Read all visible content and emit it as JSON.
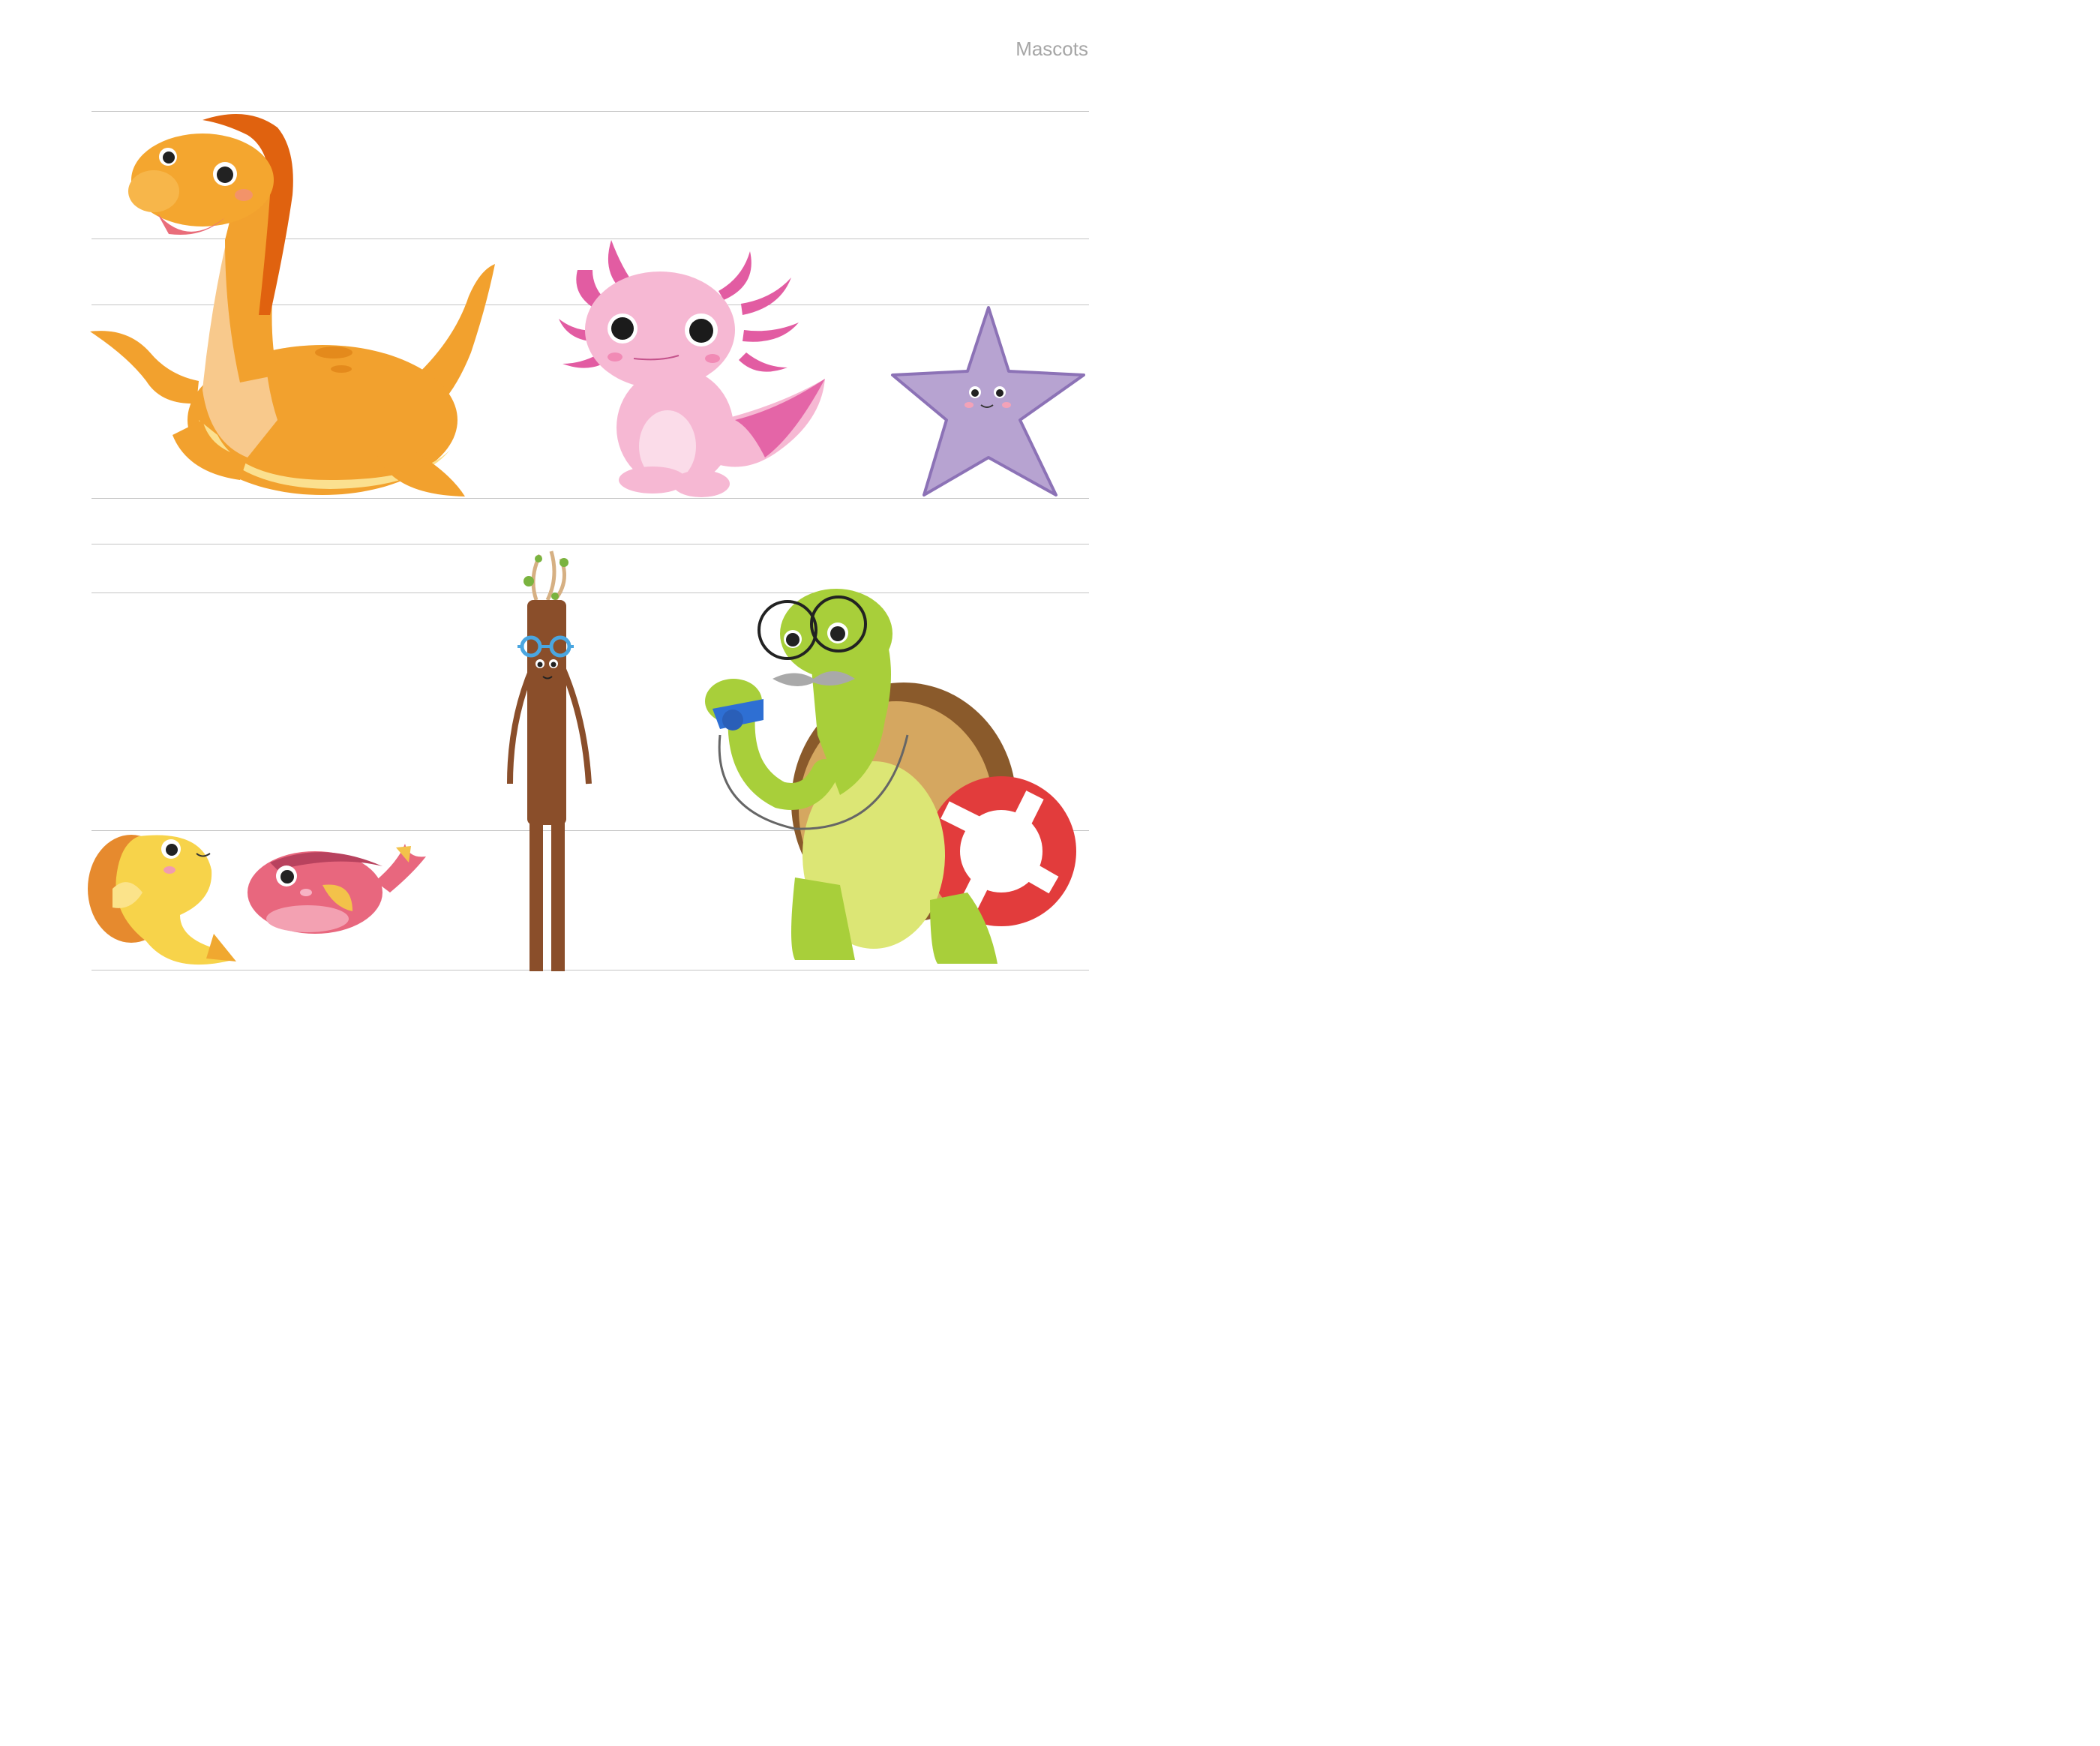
{
  "page": {
    "title": "Mascots"
  },
  "mascots": [
    {
      "name": "plesiosaur",
      "color": "#f2a12e"
    },
    {
      "name": "axolotl",
      "color": "#f6b8d3"
    },
    {
      "name": "starfish",
      "color": "#b7a3d1"
    },
    {
      "name": "yellow-fish",
      "color": "#f7d34a"
    },
    {
      "name": "pink-fish",
      "color": "#e8677e"
    },
    {
      "name": "stick-figure",
      "color": "#8a4e2a"
    },
    {
      "name": "turtle",
      "color": "#a8cf3a"
    }
  ]
}
